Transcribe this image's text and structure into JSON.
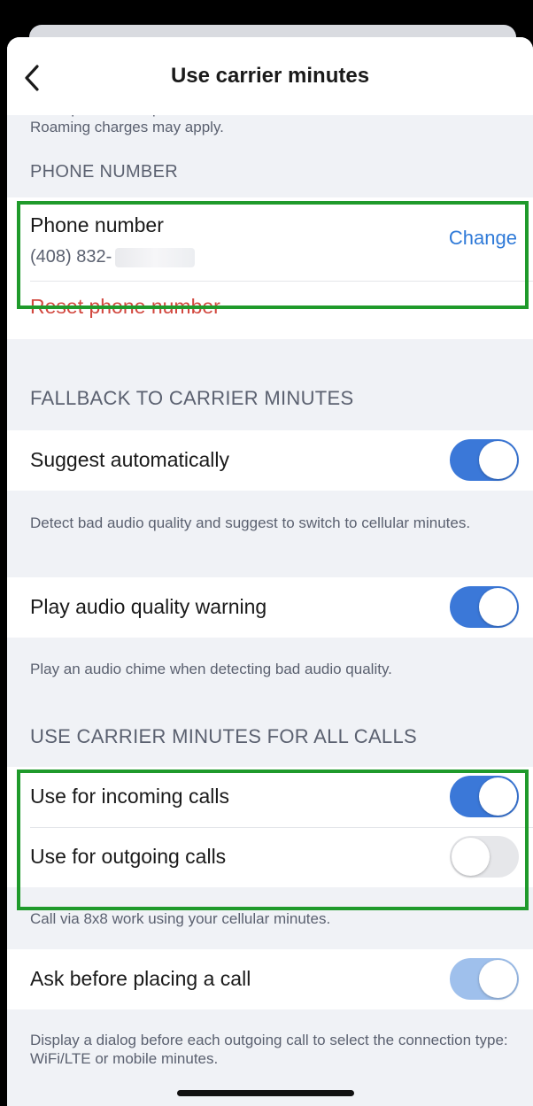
{
  "nav": {
    "title": "Use carrier minutes",
    "back_icon": "chevron-left-icon"
  },
  "intro_note": "This option still requires a small amount of data to initialize the call. Roaming charges may apply.",
  "phone_section": {
    "header": "PHONE NUMBER",
    "label": "Phone number",
    "value": "(408) 832-",
    "change_label": "Change",
    "reset_label": "Reset phone number",
    "accent": "#2f7ad8",
    "reset_color": "#d2483f"
  },
  "fallback_section": {
    "header": "FALLBACK TO CARRIER MINUTES",
    "suggest_label": "Suggest automatically",
    "suggest_on": true,
    "suggest_note": "Detect bad audio quality and suggest to switch to cellular minutes.",
    "warning_label": "Play audio quality warning",
    "warning_on": true,
    "warning_note": "Play an audio chime when detecting bad audio quality."
  },
  "all_calls_section": {
    "header": "USE CARRIER MINUTES FOR ALL CALLS",
    "incoming_label": "Use for incoming calls",
    "incoming_on": true,
    "outgoing_label": "Use for outgoing calls",
    "outgoing_on": false,
    "note": "Call via 8x8 work using your cellular minutes."
  },
  "ask_section": {
    "label": "Ask before placing a call",
    "on": true,
    "note": "Display a dialog before each outgoing call to select the connection type: WiFi/LTE or mobile minutes."
  },
  "colors": {
    "toggle_on": "#3b78d8",
    "highlight": "#1f9a2b"
  }
}
